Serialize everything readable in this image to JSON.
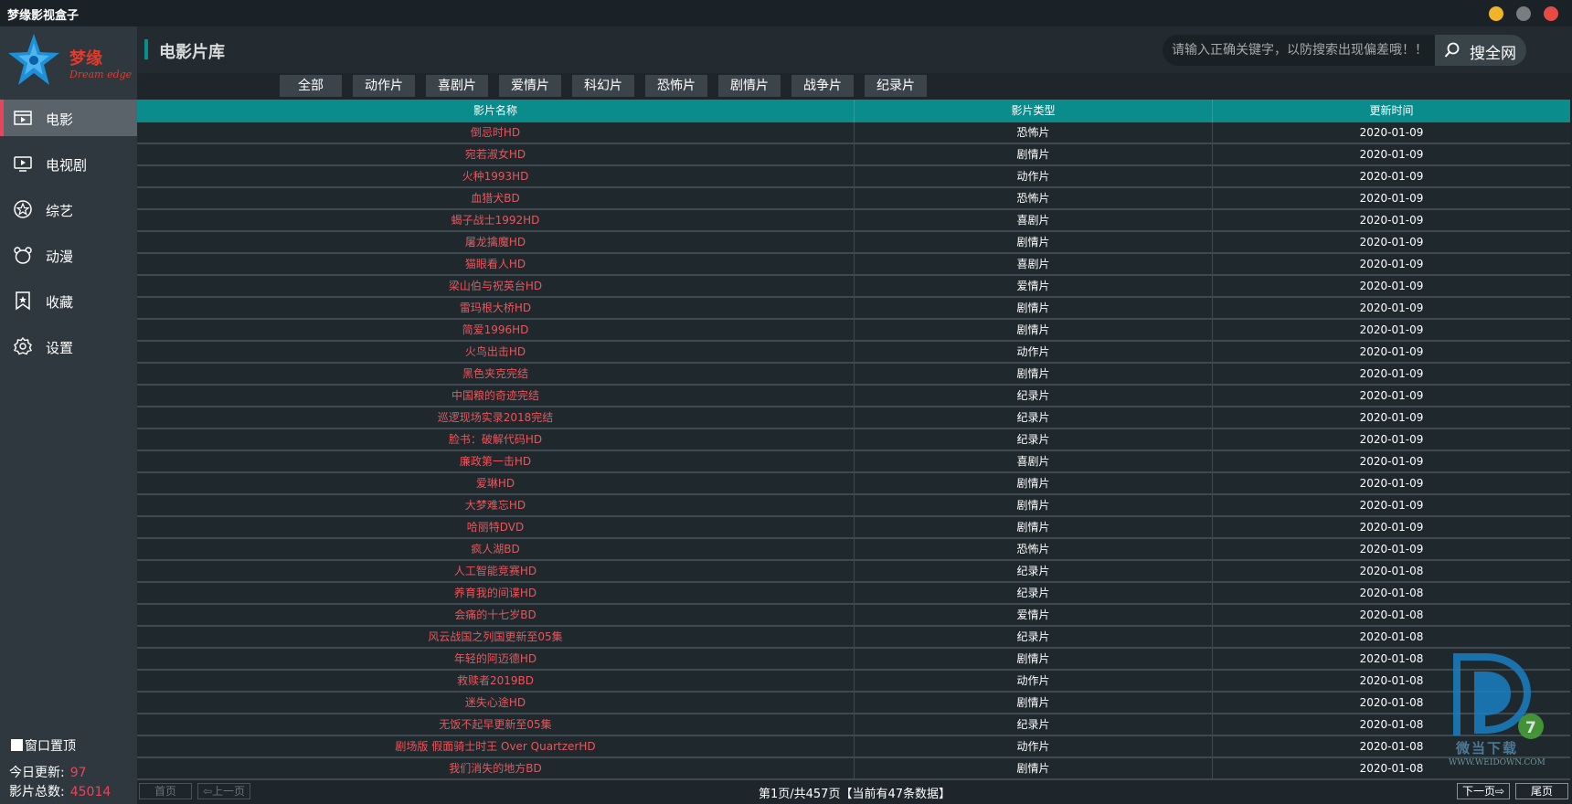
{
  "window": {
    "title": "梦缘影视盒子"
  },
  "logo": {
    "brand_cn": "梦缘",
    "brand_en": "Dream edge"
  },
  "sidebar": {
    "items": [
      {
        "label": "电影",
        "icon": "film-icon",
        "active": true
      },
      {
        "label": "电视剧",
        "icon": "tv-icon",
        "active": false
      },
      {
        "label": "综艺",
        "icon": "star-circle-icon",
        "active": false
      },
      {
        "label": "动漫",
        "icon": "bear-icon",
        "active": false
      },
      {
        "label": "收藏",
        "icon": "bookmark-star-icon",
        "active": false
      },
      {
        "label": "设置",
        "icon": "gear-icon",
        "active": false
      }
    ],
    "pin_label": "窗口置顶",
    "today_label": "今日更新:",
    "today_value": "97",
    "total_label": "影片总数:",
    "total_value": "45014"
  },
  "header": {
    "title": "电影片库",
    "search_placeholder": "请输入正确关键字，以防搜索出现偏差哦！！",
    "search_button": "搜全网"
  },
  "tabs": [
    "全部",
    "动作片",
    "喜剧片",
    "爱情片",
    "科幻片",
    "恐怖片",
    "剧情片",
    "战争片",
    "纪录片"
  ],
  "table": {
    "columns": [
      "影片名称",
      "影片类型",
      "更新时间"
    ],
    "rows": [
      [
        "倒忌时HD",
        "恐怖片",
        "2020-01-09"
      ],
      [
        "宛若淑女HD",
        "剧情片",
        "2020-01-09"
      ],
      [
        "火种1993HD",
        "动作片",
        "2020-01-09"
      ],
      [
        "血猎犬BD",
        "恐怖片",
        "2020-01-09"
      ],
      [
        "蝎子战士1992HD",
        "喜剧片",
        "2020-01-09"
      ],
      [
        "屠龙擒魔HD",
        "剧情片",
        "2020-01-09"
      ],
      [
        "猫眼看人HD",
        "喜剧片",
        "2020-01-09"
      ],
      [
        "梁山伯与祝英台HD",
        "爱情片",
        "2020-01-09"
      ],
      [
        "雷玛根大桥HD",
        "剧情片",
        "2020-01-09"
      ],
      [
        "简爱1996HD",
        "剧情片",
        "2020-01-09"
      ],
      [
        "火鸟出击HD",
        "动作片",
        "2020-01-09"
      ],
      [
        "黑色夹克完结",
        "剧情片",
        "2020-01-09"
      ],
      [
        "中国粮的奇迹完结",
        "纪录片",
        "2020-01-09"
      ],
      [
        "巡逻现场实录2018完结",
        "纪录片",
        "2020-01-09"
      ],
      [
        "脸书：破解代码HD",
        "纪录片",
        "2020-01-09"
      ],
      [
        "廉政第一击HD",
        "喜剧片",
        "2020-01-09"
      ],
      [
        "爱琳HD",
        "剧情片",
        "2020-01-09"
      ],
      [
        "大梦难忘HD",
        "剧情片",
        "2020-01-09"
      ],
      [
        "哈丽特DVD",
        "剧情片",
        "2020-01-09"
      ],
      [
        "疯人湖BD",
        "恐怖片",
        "2020-01-09"
      ],
      [
        "人工智能竞赛HD",
        "纪录片",
        "2020-01-08"
      ],
      [
        "养育我的间谍HD",
        "纪录片",
        "2020-01-08"
      ],
      [
        "会痛的十七岁BD",
        "爱情片",
        "2020-01-08"
      ],
      [
        "风云战国之列国更新至05集",
        "纪录片",
        "2020-01-08"
      ],
      [
        "年轻的阿迈德HD",
        "剧情片",
        "2020-01-08"
      ],
      [
        "救赎者2019BD",
        "动作片",
        "2020-01-08"
      ],
      [
        "迷失心途HD",
        "剧情片",
        "2020-01-08"
      ],
      [
        "无饭不起早更新至05集",
        "纪录片",
        "2020-01-08"
      ],
      [
        "剧场版 假面骑士时王 Over QuartzerHD",
        "动作片",
        "2020-01-08"
      ],
      [
        "我们消失的地方BD",
        "剧情片",
        "2020-01-08"
      ]
    ]
  },
  "pager": {
    "first": "首页",
    "prev": "⇦上一页",
    "info": "第1页/共457页【当前有47条数据】",
    "next": "下一页⇨",
    "last": "尾页"
  },
  "watermark": {
    "cn": "微当下载",
    "en": "WWW.WEIDOWN.COM"
  },
  "colors": {
    "accent": "#0a8c8c",
    "title_text": "#e7575d",
    "active_marker": "#e8465a"
  }
}
